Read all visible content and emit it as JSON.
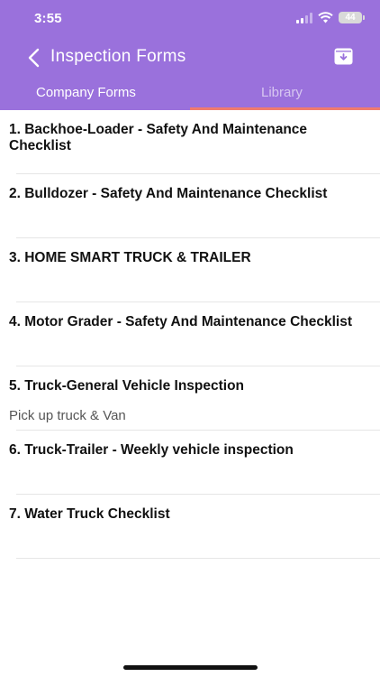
{
  "status_bar": {
    "time": "3:55",
    "battery": "44"
  },
  "nav": {
    "title": "Inspection Forms"
  },
  "tabs": [
    {
      "label": "Company Forms",
      "active": true
    },
    {
      "label": "Library",
      "active": false
    }
  ],
  "colors": {
    "header": "#9a71dc",
    "tab_indicator": "#ef7b6e"
  },
  "forms": [
    {
      "title": "1. Backhoe-Loader - Safety And Maintenance Checklist",
      "subtitle": ""
    },
    {
      "title": "2. Bulldozer - Safety And Maintenance Checklist",
      "subtitle": ""
    },
    {
      "title": "3. HOME SMART TRUCK & TRAILER",
      "subtitle": ""
    },
    {
      "title": "4. Motor Grader - Safety And Maintenance Checklist",
      "subtitle": ""
    },
    {
      "title": "5. Truck-General Vehicle Inspection",
      "subtitle": "Pick up truck & Van"
    },
    {
      "title": "6. Truck-Trailer - Weekly vehicle inspection",
      "subtitle": ""
    },
    {
      "title": "7. Water Truck Checklist",
      "subtitle": ""
    }
  ]
}
